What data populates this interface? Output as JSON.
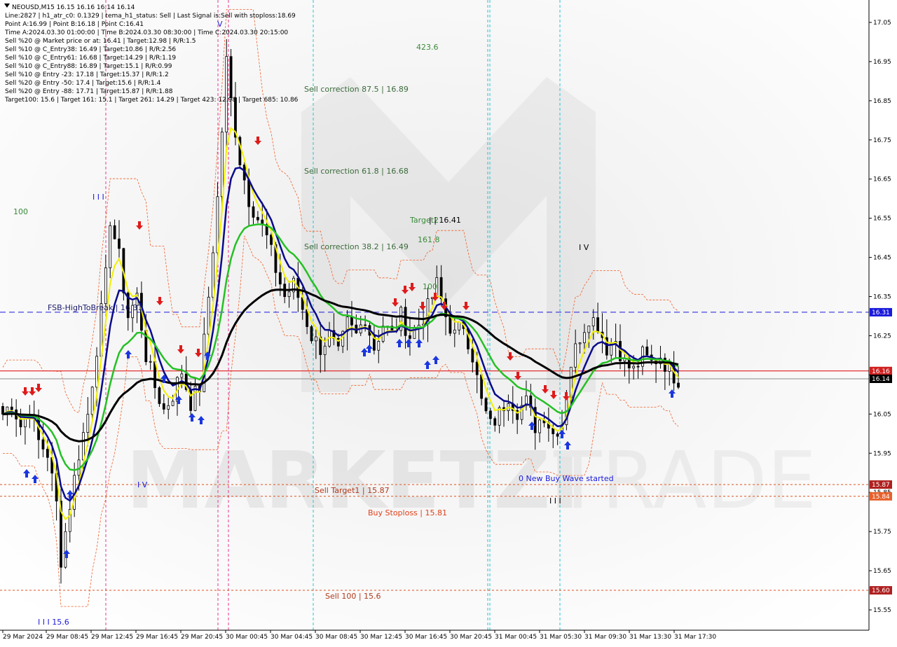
{
  "header": {
    "symbol_line": "NEOUSD,M15  16.15 16.16 16.14 16.14",
    "info_lines": [
      "Line:2827  |  h1_atr_c0: 0.1329  |  tema_h1_status: Sell  |  Last Signal is:Sell with stoploss:18.69",
      "Point A:16.99  |  Point B:16.18  |  Point C:16.41",
      "Time A:2024.03.30 01:00:00  |  Time B:2024.03.30 08:30:00  |  Time C:2024.03.30 20:15:00",
      "Sell %20 @ Market price or at: 16.41  |  Target:12.98  |  R/R:1.5",
      "Sell %10 @ C_Entry38: 16.49  |  Target:10.86  |  R/R:2.56",
      "Sell %10 @ C_Entry61: 16.68  |  Target:14.29  |  R/R:1.19",
      "Sell %10 @ C_Entry88: 16.89  |  Target:15.1  |  R/R:0.99",
      "Sell %10 @ Entry -23: 17.18  |  Target:15.37  |  R/R:1.2",
      "Sell %20 @ Entry -50: 17.4  |  Target:15.6  |  R/R:1.4",
      "Sell %20 @ Entry -88: 17.71  |  Target:15.87  |  R/R:1.88",
      "Target100: 15.6  |  Target 161: 15.1  |  Target 261: 14.29  |  Target 423: 12.98  |  Target 685: 10.86"
    ]
  },
  "annotations": {
    "sell_correction_875": "Sell correction 87.5 | 16.89",
    "sell_correction_618": "Sell correction 61.8 | 16.68",
    "sell_correction_382": "Sell correction 38.2 | 16.49",
    "fsb_high": "FSB-HighToBreak | 16.31",
    "sell_target1": "Sell Target1 | 15.87",
    "buy_stoploss": "Buy Stoploss | 15.81",
    "sell_100": "Sell 100 | 15.6",
    "new_buy_wave": "0 New Buy Wave started",
    "target_423": "423.6",
    "target_label": "Target2",
    "point_c": "| | 16.41",
    "target_1618": "161.8",
    "target_100": "100",
    "left_100": "100",
    "wave_iii_bottom": "I I I 15.6",
    "wave_iii_top": "I I I",
    "wave_v_top": "V",
    "wave_iv_left": "I V",
    "wave_iv_right": "I V",
    "wave_iii_right": "I I I"
  },
  "colors": {
    "background": "#ffffff",
    "candle": "#000000",
    "fsb_line": "#1a1adc",
    "red_line": "#e00000",
    "orange_dotted": "#e0501a",
    "cyan_vline": "#27c4d4",
    "pink_vline": "#e8368e",
    "tema_yellow": "#f0f000",
    "ema_navy": "#0a0a8c",
    "ema_green": "#24c024",
    "ema_black": "#000000",
    "channel_orange": "#f0602a",
    "badge_blue": "#1a1adc",
    "badge_red": "#d02020",
    "badge_gray": "#000000",
    "badge_darkred": "#b02020",
    "badge_orange": "#e8602a",
    "arrow_up": "#1a36e0",
    "arrow_down": "#e01a1a",
    "label_green": "#3a8a3a",
    "label_brown": "#b03a1a",
    "label_blue": "#1a1adc"
  },
  "chart_data": {
    "type": "candlestick",
    "symbol": "NEOUSD",
    "timeframe": "M15",
    "ylim": [
      15.5,
      17.1
    ],
    "y_ticks": [
      17.05,
      16.95,
      16.85,
      16.75,
      16.65,
      16.55,
      16.45,
      16.35,
      16.25,
      16.15,
      16.05,
      15.95,
      15.85,
      15.75,
      15.65,
      15.55
    ],
    "x_labels": [
      "29 Mar 2024",
      "29 Mar 08:45",
      "29 Mar 12:45",
      "29 Mar 16:45",
      "29 Mar 20:45",
      "30 Mar 00:45",
      "30 Mar 04:45",
      "30 Mar 08:45",
      "30 Mar 12:45",
      "30 Mar 16:45",
      "30 Mar 20:45",
      "31 Mar 00:45",
      "31 Mar 05:30",
      "31 Mar 09:30",
      "31 Mar 13:30",
      "31 Mar 17:30"
    ],
    "price_badges": [
      {
        "price": 16.31,
        "label": "16.31",
        "color_key": "badge_blue"
      },
      {
        "price": 16.16,
        "label": "16.16",
        "color_key": "badge_red"
      },
      {
        "price": 16.14,
        "label": "16.14",
        "color_key": "badge_gray"
      },
      {
        "price": 15.87,
        "label": "15.87",
        "color_key": "badge_darkred"
      },
      {
        "price": 15.84,
        "label": "15.84",
        "color_key": "badge_orange"
      },
      {
        "price": 15.6,
        "label": "15.60",
        "color_key": "badge_darkred"
      }
    ],
    "levels": {
      "fsb_high": 16.31,
      "red_line": 16.16,
      "current": 16.14,
      "sell_target1": 15.87,
      "buy_stoploss": 15.84,
      "sell_100": 15.6
    },
    "close_path": [
      [
        0,
        16.05
      ],
      [
        2,
        16.08
      ],
      [
        4,
        16.02
      ],
      [
        6,
        16.06
      ],
      [
        8,
        15.98
      ],
      [
        10,
        15.95
      ],
      [
        12,
        15.82
      ],
      [
        13,
        15.68
      ],
      [
        15,
        15.82
      ],
      [
        17,
        15.95
      ],
      [
        19,
        16.05
      ],
      [
        21,
        16.22
      ],
      [
        23,
        16.4
      ],
      [
        24,
        16.55
      ],
      [
        26,
        16.45
      ],
      [
        28,
        16.3
      ],
      [
        30,
        16.35
      ],
      [
        32,
        16.2
      ],
      [
        34,
        16.12
      ],
      [
        36,
        16.06
      ],
      [
        38,
        16.1
      ],
      [
        40,
        16.16
      ],
      [
        42,
        16.08
      ],
      [
        44,
        16.12
      ],
      [
        46,
        16.35
      ],
      [
        48,
        16.6
      ],
      [
        50,
        16.95
      ],
      [
        51,
        16.85
      ],
      [
        53,
        16.7
      ],
      [
        55,
        16.6
      ],
      [
        57,
        16.55
      ],
      [
        59,
        16.5
      ],
      [
        61,
        16.42
      ],
      [
        63,
        16.35
      ],
      [
        65,
        16.38
      ],
      [
        67,
        16.32
      ],
      [
        69,
        16.25
      ],
      [
        71,
        16.22
      ],
      [
        73,
        16.25
      ],
      [
        75,
        16.2
      ],
      [
        77,
        16.28
      ],
      [
        79,
        16.25
      ],
      [
        81,
        16.3
      ],
      [
        83,
        16.22
      ],
      [
        85,
        16.28
      ],
      [
        87,
        16.25
      ],
      [
        89,
        16.3
      ],
      [
        91,
        16.25
      ],
      [
        93,
        16.28
      ],
      [
        95,
        16.32
      ],
      [
        97,
        16.38
      ],
      [
        99,
        16.3
      ],
      [
        101,
        16.25
      ],
      [
        103,
        16.28
      ],
      [
        105,
        16.2
      ],
      [
        107,
        16.08
      ],
      [
        109,
        16.02
      ],
      [
        111,
        16.05
      ],
      [
        113,
        16.1
      ],
      [
        115,
        16.06
      ],
      [
        117,
        16.08
      ],
      [
        119,
        16.02
      ],
      [
        121,
        16.05
      ],
      [
        123,
        16.0
      ],
      [
        125,
        16.03
      ],
      [
        127,
        16.18
      ],
      [
        129,
        16.25
      ],
      [
        131,
        16.3
      ],
      [
        133,
        16.28
      ],
      [
        135,
        16.22
      ],
      [
        137,
        16.24
      ],
      [
        139,
        16.18
      ],
      [
        141,
        16.16
      ],
      [
        143,
        16.2
      ],
      [
        145,
        16.18
      ],
      [
        147,
        16.2
      ],
      [
        149,
        16.16
      ],
      [
        151,
        16.14
      ]
    ]
  }
}
